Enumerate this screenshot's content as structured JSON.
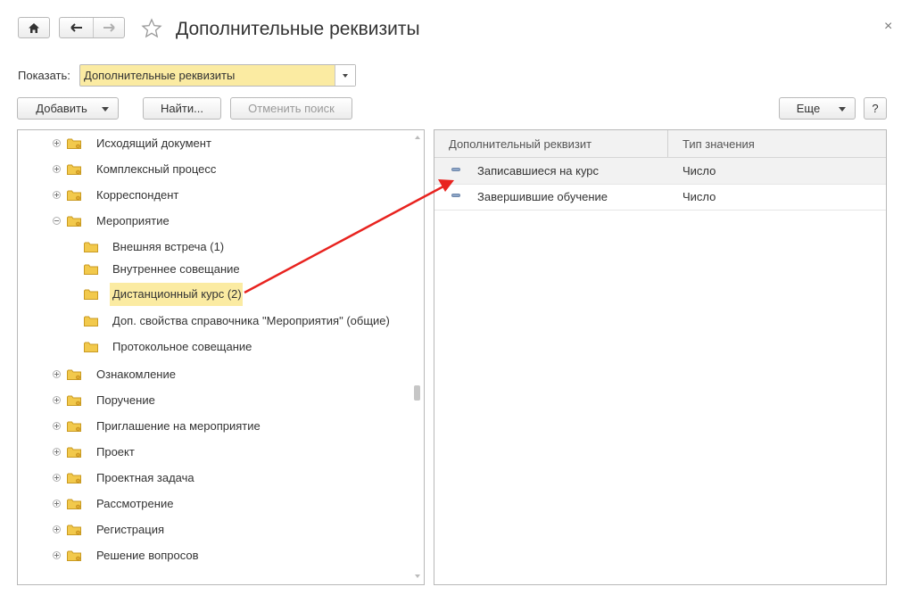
{
  "window": {
    "title": "Дополнительные реквизиты",
    "close_symbol": "×"
  },
  "filter": {
    "label": "Показать:",
    "value": "Дополнительные реквизиты"
  },
  "toolbar": {
    "add_label": "Добавить",
    "find_label": "Найти...",
    "cancel_search_label": "Отменить поиск",
    "more_label": "Еще",
    "help_label": "?"
  },
  "tree": {
    "items": [
      {
        "label": "Исходящий документ",
        "expander": "plus"
      },
      {
        "label": "Комплексный процесс",
        "expander": "plus"
      },
      {
        "label": "Корреспондент",
        "expander": "plus"
      },
      {
        "label": "Мероприятие",
        "expander": "minus"
      },
      {
        "label": "Внешняя встреча (1)",
        "expander": "none"
      },
      {
        "label": "Внутреннее совещание",
        "expander": "none"
      },
      {
        "label": "Дистанционный курс (2)",
        "expander": "none",
        "selected": true
      },
      {
        "label": "Доп. свойства справочника \"Мероприятия\" (общие)",
        "expander": "none"
      },
      {
        "label": "Протокольное совещание",
        "expander": "none"
      },
      {
        "label": "Ознакомление",
        "expander": "plus"
      },
      {
        "label": "Поручение",
        "expander": "plus"
      },
      {
        "label": "Приглашение на мероприятие",
        "expander": "plus"
      },
      {
        "label": "Проект",
        "expander": "plus"
      },
      {
        "label": "Проектная задача",
        "expander": "plus"
      },
      {
        "label": "Рассмотрение",
        "expander": "plus"
      },
      {
        "label": "Регистрация",
        "expander": "plus"
      },
      {
        "label": "Решение вопросов",
        "expander": "plus"
      }
    ]
  },
  "grid": {
    "columns": [
      "Дополнительный реквизит",
      "Тип значения"
    ],
    "rows": [
      {
        "name": "Записавшиеся на курс",
        "type": "Число"
      },
      {
        "name": "Завершившие обучение",
        "type": "Число"
      }
    ]
  },
  "colors": {
    "highlight": "#fbeba2",
    "arrow": "#e8231f",
    "folder": "#f2c94c"
  }
}
